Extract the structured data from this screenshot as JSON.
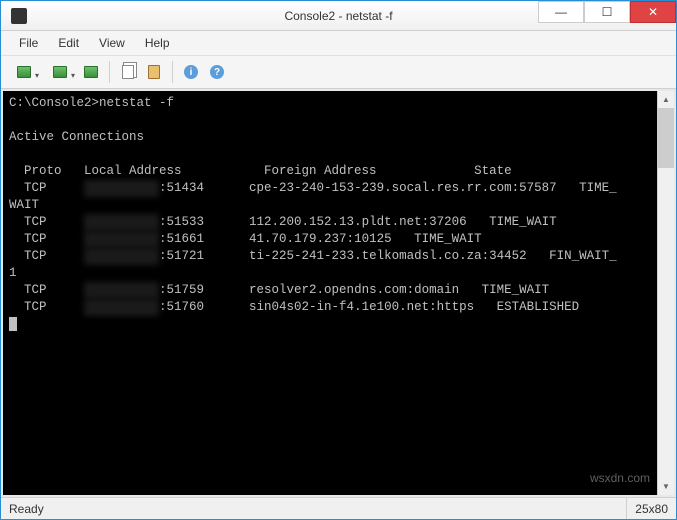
{
  "window": {
    "title": "Console2 - netstat  -f"
  },
  "menu": {
    "file": "File",
    "edit": "Edit",
    "view": "View",
    "help": "Help"
  },
  "status": {
    "left": "Ready",
    "right": "25x80"
  },
  "terminal": {
    "prompt": "C:\\Console2>",
    "command": "netstat -f",
    "header": "Active Connections",
    "col_proto": "Proto",
    "col_local": "Local Address",
    "col_foreign": "Foreign Address",
    "col_state": "State",
    "rows": [
      {
        "proto": "TCP",
        "lport": ":51434",
        "foreign": "cpe-23-240-153-239.socal.res.rr.com:57587",
        "state": "TIME_",
        "wrap": "WAIT"
      },
      {
        "proto": "TCP",
        "lport": ":51533",
        "foreign": "112.200.152.13.pldt.net:37206",
        "state": "TIME_WAIT",
        "wrap": ""
      },
      {
        "proto": "TCP",
        "lport": ":51661",
        "foreign": "41.70.179.237:10125",
        "state": "TIME_WAIT",
        "wrap": ""
      },
      {
        "proto": "TCP",
        "lport": ":51721",
        "foreign": "ti-225-241-233.telkomadsl.co.za:34452",
        "state": "FIN_WAIT_",
        "wrap": "1"
      },
      {
        "proto": "TCP",
        "lport": ":51759",
        "foreign": "resolver2.opendns.com:domain",
        "state": "TIME_WAIT",
        "wrap": ""
      },
      {
        "proto": "TCP",
        "lport": ":51760",
        "foreign": "sin04s02-in-f4.1e100.net:https",
        "state": "ESTABLISHED",
        "wrap": ""
      }
    ]
  },
  "watermark": "wsxdn.com"
}
